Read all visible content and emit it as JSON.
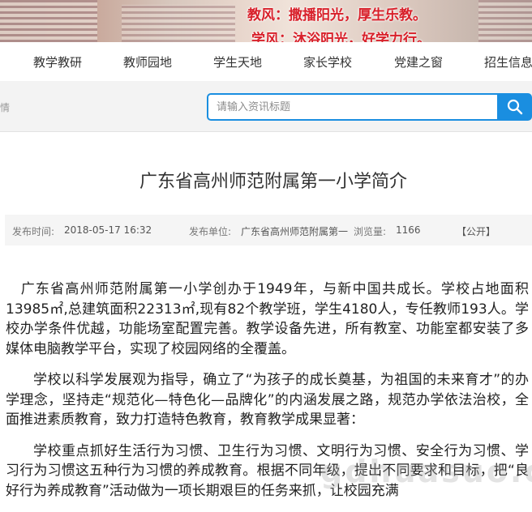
{
  "banner": {
    "motto_teachers": "教风：撒播阳光，厚生乐教。",
    "motto_students": "学风：沐浴阳光，好学力行。"
  },
  "nav": {
    "items": [
      "教学教研",
      "教师园地",
      "学生天地",
      "家长学校",
      "党建之窗",
      "招生信息"
    ]
  },
  "search": {
    "left_fragment": "情",
    "placeholder": "请输入资讯标题"
  },
  "article": {
    "title": "广东省高州师范附属第一小学简介",
    "meta": {
      "publish_time_label": "发布时间:",
      "publish_time": "2018-05-17 16:32",
      "publisher_label": "发布单位:",
      "publisher": "广东省高州师范附属第一",
      "views_label": "浏览量:",
      "views": "1166",
      "visibility": "【公开】"
    },
    "paragraphs": [
      "广东省高州师范附属第一小学创办于1949年，与新中国共成长。学校占地面积13985㎡,总建筑面积22313㎡,现有82个教学班，学生4180人，专任教师193人。学校办学条件优越，功能场室配置完善。教学设备先进，所有教室、功能室都安装了多媒体电脑教学平台，实现了校园网络的全覆盖。",
      "学校以科学发展观为指导，确立了“为孩子的成长奠基，为祖国的未来育才”的办学理念，坚持走“规范化—特色化—品牌化”的内涵发展之路，规范办学依法治校，全面推进素质教育，致力打造特色教育，教育教学成果显著：",
      "学校重点抓好生活行为习惯、卫生行为习惯、文明行为习惯、安全行为习惯、学习行为习惯这五种行为习惯的养成教育。根据不同年级，提出不同要求和目标，把“良好行为养成教育”活动做为一项长期艰巨的任务来抓，让校园充满"
    ]
  },
  "watermark": "gdhuasuo.com",
  "colors": {
    "accent": "#1a8ee0",
    "motto_red": "#d8202a"
  }
}
